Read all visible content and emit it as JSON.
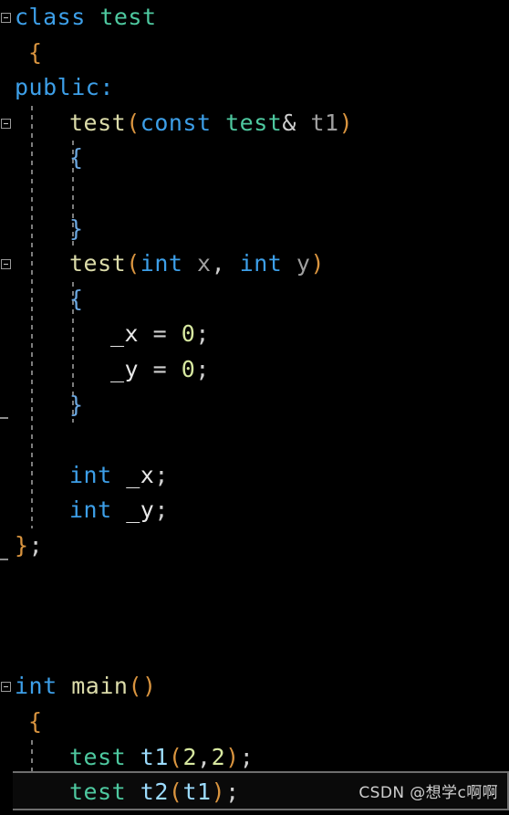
{
  "editor": {
    "language": "cpp",
    "theme": "dark",
    "background_color": "#000000",
    "font_size_px": 25,
    "line_height_px": 38.6,
    "current_line_number": 23,
    "colors": {
      "keyword": "#3d9fe8",
      "user_type": "#4ec9a0",
      "function": "#dcdcaa",
      "variable": "#9cdcfe",
      "parameter": "#a0a0a0",
      "member": "#e8e8e8",
      "number": "#d7e8a0",
      "punctuation": "#cfcfcf",
      "paren": "#d9943f",
      "brace_outer": "#d9943f",
      "brace_inner": "#6ba7e0",
      "indent_guide": "#7d7d7d",
      "fold_marker": "#9a9a9a",
      "current_line_border": "#6e6e6e"
    }
  },
  "code_lines": [
    {
      "n": 1,
      "indent": 0,
      "tokens": [
        {
          "t": "class",
          "c": "kw"
        },
        {
          "t": " ",
          "c": "punc"
        },
        {
          "t": "test",
          "c": "type"
        }
      ]
    },
    {
      "n": 2,
      "indent": 1,
      "tokens": [
        {
          "t": "{",
          "c": "brace-o"
        }
      ]
    },
    {
      "n": 3,
      "indent": 0,
      "tokens": [
        {
          "t": "public",
          "c": "kw"
        },
        {
          "t": ":",
          "c": "kw"
        }
      ]
    },
    {
      "n": 4,
      "indent": 4,
      "tokens": [
        {
          "t": "test",
          "c": "fn"
        },
        {
          "t": "(",
          "c": "paren"
        },
        {
          "t": "const",
          "c": "kw"
        },
        {
          "t": " ",
          "c": "punc"
        },
        {
          "t": "test",
          "c": "type"
        },
        {
          "t": "&",
          "c": "punc"
        },
        {
          "t": " ",
          "c": "punc"
        },
        {
          "t": "t1",
          "c": "param"
        },
        {
          "t": ")",
          "c": "paren"
        }
      ]
    },
    {
      "n": 5,
      "indent": 4,
      "tokens": [
        {
          "t": "{",
          "c": "brace-i"
        }
      ]
    },
    {
      "n": 6,
      "indent": 0,
      "tokens": []
    },
    {
      "n": 7,
      "indent": 4,
      "tokens": [
        {
          "t": "}",
          "c": "brace-i"
        }
      ]
    },
    {
      "n": 8,
      "indent": 4,
      "tokens": [
        {
          "t": "test",
          "c": "fn"
        },
        {
          "t": "(",
          "c": "paren"
        },
        {
          "t": "int",
          "c": "kw"
        },
        {
          "t": " ",
          "c": "punc"
        },
        {
          "t": "x",
          "c": "param"
        },
        {
          "t": ",",
          "c": "punc"
        },
        {
          "t": " ",
          "c": "punc"
        },
        {
          "t": "int",
          "c": "kw"
        },
        {
          "t": " ",
          "c": "punc"
        },
        {
          "t": "y",
          "c": "param"
        },
        {
          "t": ")",
          "c": "paren"
        }
      ]
    },
    {
      "n": 9,
      "indent": 4,
      "tokens": [
        {
          "t": "{",
          "c": "brace-i"
        }
      ]
    },
    {
      "n": 10,
      "indent": 7,
      "tokens": [
        {
          "t": "_x",
          "c": "member"
        },
        {
          "t": " = ",
          "c": "punc"
        },
        {
          "t": "0",
          "c": "num"
        },
        {
          "t": ";",
          "c": "punc"
        }
      ]
    },
    {
      "n": 11,
      "indent": 7,
      "tokens": [
        {
          "t": "_y",
          "c": "member"
        },
        {
          "t": " = ",
          "c": "punc"
        },
        {
          "t": "0",
          "c": "num"
        },
        {
          "t": ";",
          "c": "punc"
        }
      ]
    },
    {
      "n": 12,
      "indent": 4,
      "tokens": [
        {
          "t": "}",
          "c": "brace-i"
        }
      ]
    },
    {
      "n": 13,
      "indent": 0,
      "tokens": []
    },
    {
      "n": 14,
      "indent": 4,
      "tokens": [
        {
          "t": "int",
          "c": "kw"
        },
        {
          "t": " ",
          "c": "punc"
        },
        {
          "t": "_x",
          "c": "member"
        },
        {
          "t": ";",
          "c": "punc"
        }
      ]
    },
    {
      "n": 15,
      "indent": 4,
      "tokens": [
        {
          "t": "int",
          "c": "kw"
        },
        {
          "t": " ",
          "c": "punc"
        },
        {
          "t": "_y",
          "c": "member"
        },
        {
          "t": ";",
          "c": "punc"
        }
      ]
    },
    {
      "n": 16,
      "indent": 0,
      "tokens": [
        {
          "t": "}",
          "c": "brace-o"
        },
        {
          "t": ";",
          "c": "punc"
        }
      ]
    },
    {
      "n": 17,
      "indent": 0,
      "tokens": []
    },
    {
      "n": 18,
      "indent": 0,
      "tokens": []
    },
    {
      "n": 19,
      "indent": 0,
      "tokens": []
    },
    {
      "n": 20,
      "indent": 0,
      "tokens": [
        {
          "t": "int",
          "c": "kw"
        },
        {
          "t": " ",
          "c": "punc"
        },
        {
          "t": "main",
          "c": "fn"
        },
        {
          "t": "()",
          "c": "paren"
        }
      ]
    },
    {
      "n": 21,
      "indent": 1,
      "tokens": [
        {
          "t": "{",
          "c": "brace-o"
        }
      ]
    },
    {
      "n": 22,
      "indent": 4,
      "tokens": [
        {
          "t": "test",
          "c": "type"
        },
        {
          "t": " ",
          "c": "punc"
        },
        {
          "t": "t1",
          "c": "var"
        },
        {
          "t": "(",
          "c": "paren"
        },
        {
          "t": "2",
          "c": "num"
        },
        {
          "t": ",",
          "c": "punc"
        },
        {
          "t": "2",
          "c": "num"
        },
        {
          "t": ")",
          "c": "paren"
        },
        {
          "t": ";",
          "c": "punc"
        }
      ]
    },
    {
      "n": 23,
      "indent": 4,
      "tokens": [
        {
          "t": "test",
          "c": "type"
        },
        {
          "t": " ",
          "c": "punc"
        },
        {
          "t": "t2",
          "c": "var"
        },
        {
          "t": "(",
          "c": "paren"
        },
        {
          "t": "t1",
          "c": "var"
        },
        {
          "t": ")",
          "c": "paren"
        },
        {
          "t": ";",
          "c": "punc"
        }
      ]
    }
  ],
  "fold_markers": [
    {
      "name": "fold-class-test",
      "line": 1,
      "state": "expanded"
    },
    {
      "name": "fold-copy-ctor",
      "line": 4,
      "state": "expanded"
    },
    {
      "name": "fold-param-ctor",
      "line": 8,
      "state": "expanded"
    },
    {
      "name": "fold-main",
      "line": 20,
      "state": "expanded"
    }
  ],
  "fold_ends": [
    {
      "name": "fold-end-param-ctor",
      "line": 12
    },
    {
      "name": "fold-end-class",
      "line": 16
    }
  ],
  "indent_guides": [
    {
      "name": "guide-class-body",
      "col": 1,
      "from_line": 4,
      "to_line": 15
    },
    {
      "name": "guide-ctor1-body",
      "col": 4,
      "from_line": 5,
      "to_line": 7
    },
    {
      "name": "guide-ctor2-body",
      "col": 4,
      "from_line": 9,
      "to_line": 12
    },
    {
      "name": "guide-main-body",
      "col": 1,
      "from_line": 22,
      "to_line": 23
    }
  ],
  "watermark": {
    "text": "CSDN @想学c啊啊"
  }
}
